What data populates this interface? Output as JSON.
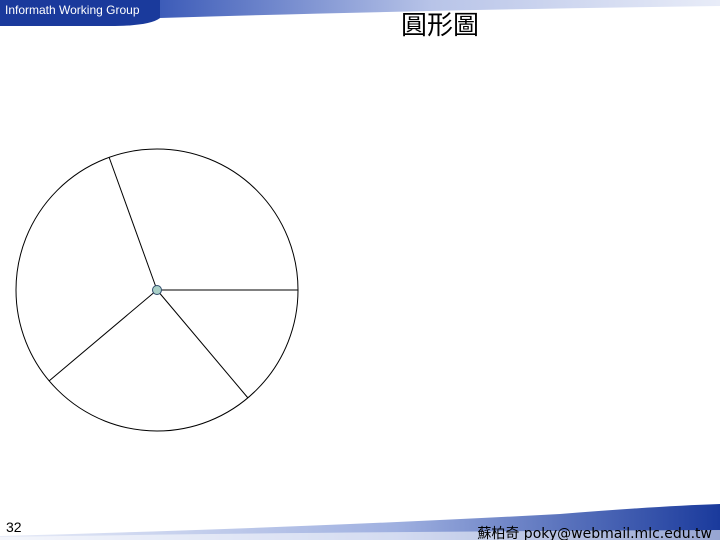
{
  "header": {
    "group_name": "Informath Working Group"
  },
  "slide": {
    "title": "圓形圖",
    "page_number": "32"
  },
  "footer": {
    "contact": "蘇柏奇 poky@webmail.mlc.edu.tw"
  },
  "colors": {
    "header_blue_dark": "#1a3a9c",
    "header_blue_light": "#c7d2ee",
    "circle_stroke": "#000000",
    "center_point_fill": "#a9cfc7"
  }
}
